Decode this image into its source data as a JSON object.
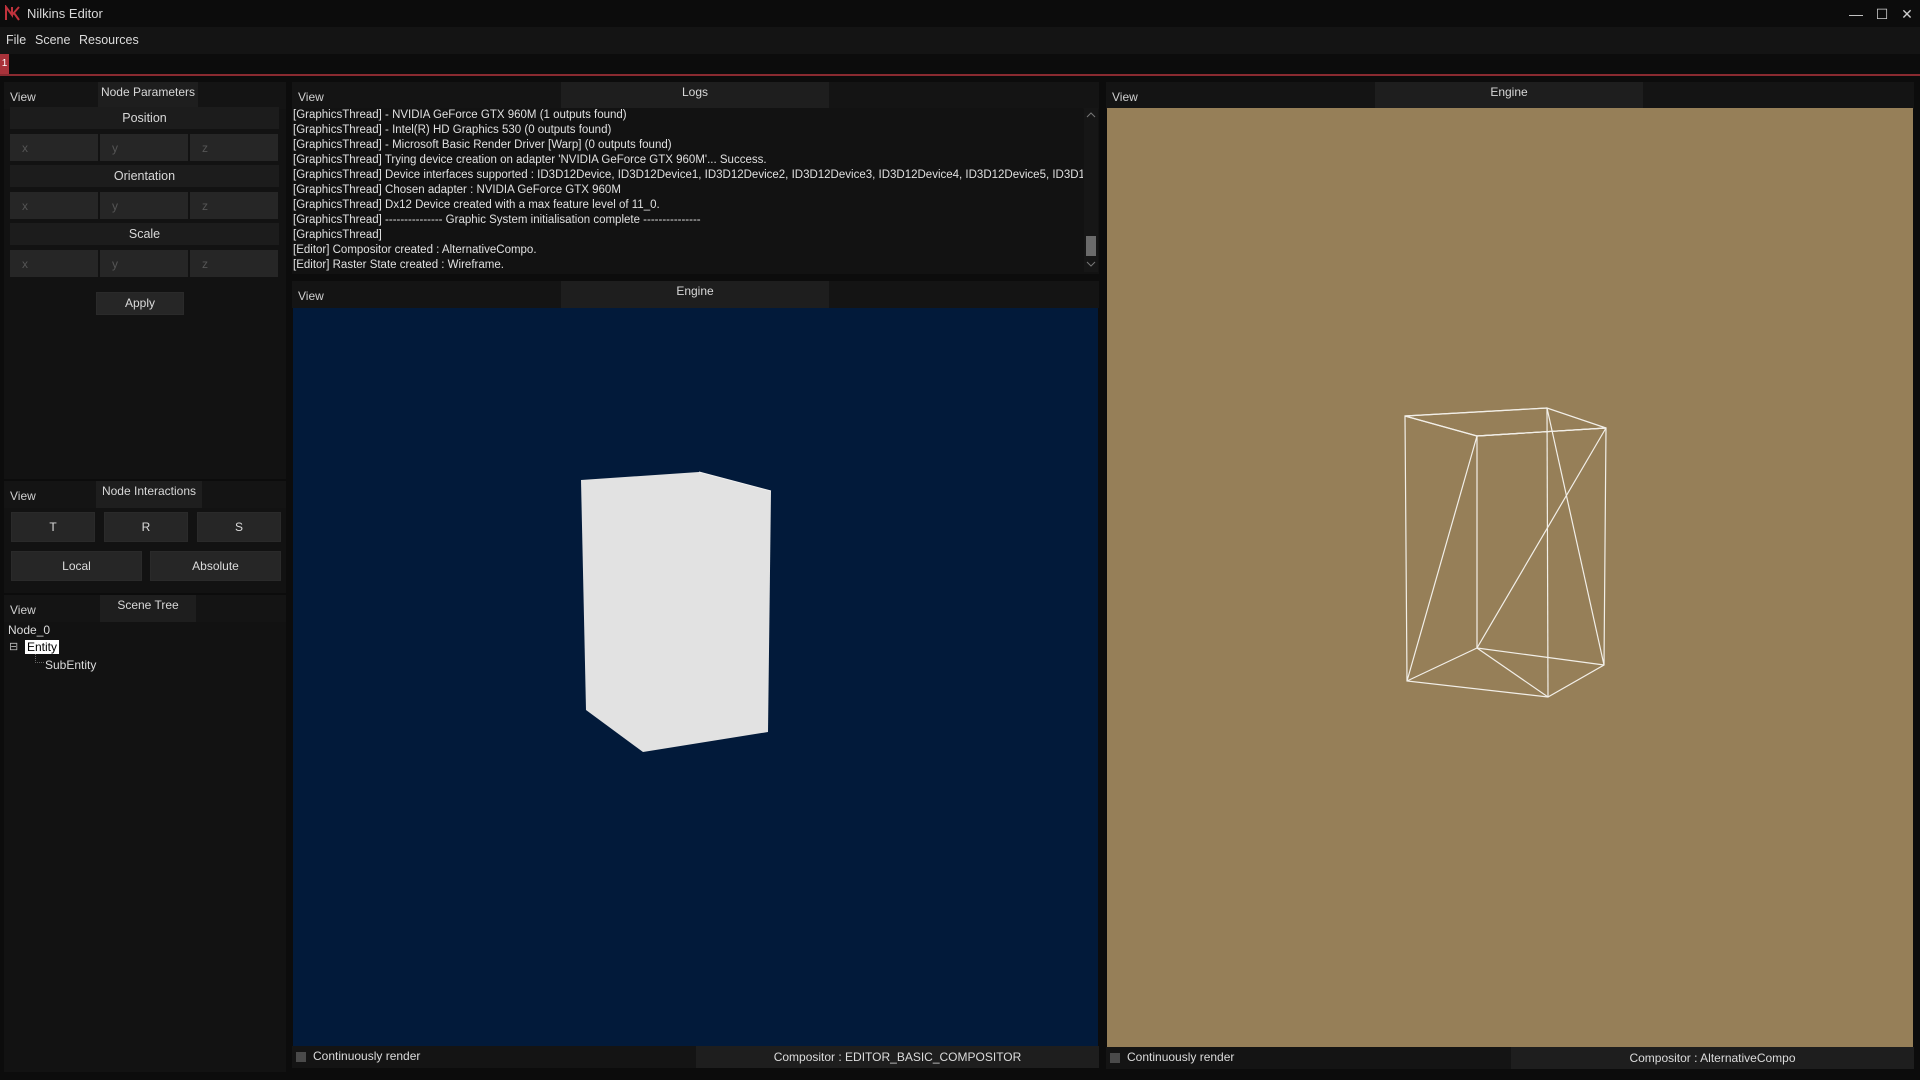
{
  "window": {
    "title": "Nilkins Editor",
    "controls": {
      "minimize": "—",
      "maximize": "☐",
      "close": "✕"
    }
  },
  "menu": [
    "File",
    "Scene",
    "Resources"
  ],
  "doc_tab": {
    "label": "1",
    "accent": "#a8323a"
  },
  "node_parameters": {
    "view_label": "View",
    "tab": "Node Parameters",
    "position": {
      "label": "Position",
      "x": "x",
      "y": "y",
      "z": "z"
    },
    "orientation": {
      "label": "Orientation",
      "x": "x",
      "y": "y",
      "z": "z"
    },
    "scale": {
      "label": "Scale",
      "x": "x",
      "y": "y",
      "z": "z"
    },
    "apply": "Apply"
  },
  "node_interactions": {
    "view_label": "View",
    "tab": "Node Interactions",
    "translate": "T",
    "rotate": "R",
    "scale": "S",
    "local": "Local",
    "absolute": "Absolute"
  },
  "scene_tree": {
    "view_label": "View",
    "tab": "Scene Tree",
    "root": "Node_0",
    "expander": "⊟",
    "entity": "Entity",
    "sub_entity": "SubEntity"
  },
  "logs": {
    "view_label": "View",
    "tab": "Logs",
    "lines": [
      "[GraphicsThread]   - NVIDIA GeForce GTX 960M (1 outputs found)",
      "[GraphicsThread]   - Intel(R) HD Graphics 530 (0 outputs found)",
      "[GraphicsThread]   - Microsoft Basic Render Driver [Warp] (0 outputs found)",
      "[GraphicsThread] Trying device creation on adapter 'NVIDIA GeForce GTX 960M'... Success.",
      "[GraphicsThread] Device interfaces supported : ID3D12Device, ID3D12Device1, ID3D12Device2, ID3D12Device3, ID3D12Device4, ID3D12Device5, ID3D12D",
      "[GraphicsThread] Chosen adapter : NVIDIA GeForce GTX 960M",
      "[GraphicsThread] Dx12 Device created with a max feature level of 11_0.",
      "[GraphicsThread] --------------- Graphic System initialisation complete ---------------",
      "[GraphicsThread]",
      "[Editor] Compositor created : AlternativeCompo.",
      "[Editor] Raster State created : Wireframe."
    ]
  },
  "engine_view_1": {
    "view_label": "View",
    "tab": "Engine",
    "background": "#021a3a",
    "continuous_render": "Continuously render",
    "compositor": "Compositor : EDITOR_BASIC_COMPOSITOR"
  },
  "engine_view_2": {
    "view_label": "View",
    "tab": "Engine",
    "background": "#967f58",
    "continuous_render": "Continuously render",
    "compositor": "Compositor : AlternativeCompo"
  }
}
